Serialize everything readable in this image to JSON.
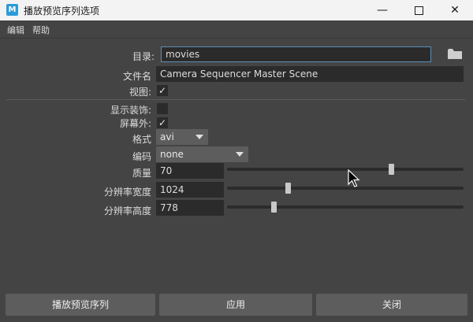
{
  "window": {
    "title": "播放预览序列选项",
    "icon_letter": "M"
  },
  "menu": {
    "items": [
      "编辑",
      "帮助"
    ]
  },
  "fields": {
    "directory": {
      "label": "目录:",
      "value": "movies"
    },
    "filename": {
      "label": "文件名",
      "value": "Camera Sequencer Master Scene"
    },
    "view": {
      "label": "视图:",
      "checked": true,
      "mark": "✓"
    }
  },
  "options": {
    "show_ornaments": {
      "label": "显示装饰:",
      "checked": false,
      "mark": ""
    },
    "offscreen": {
      "label": "屏幕外:",
      "checked": true,
      "mark": "✓"
    },
    "format": {
      "label": "格式",
      "value": "avi"
    },
    "encoding": {
      "label": "编码",
      "value": "none"
    },
    "quality": {
      "label": "质量",
      "value": "70",
      "level": 0.7
    },
    "width": {
      "label": "分辨率宽度",
      "value": "1024"
    },
    "height": {
      "label": "分辨率高度",
      "value": "778"
    }
  },
  "buttons": {
    "play": "播放预览序列",
    "apply": "应用",
    "close": "关闭"
  },
  "icons": {
    "folder": "folder-icon",
    "minimize": "minimize-icon",
    "maximize": "maximize-icon",
    "close": "close-icon",
    "cursor": "mouse-cursor-icon"
  }
}
